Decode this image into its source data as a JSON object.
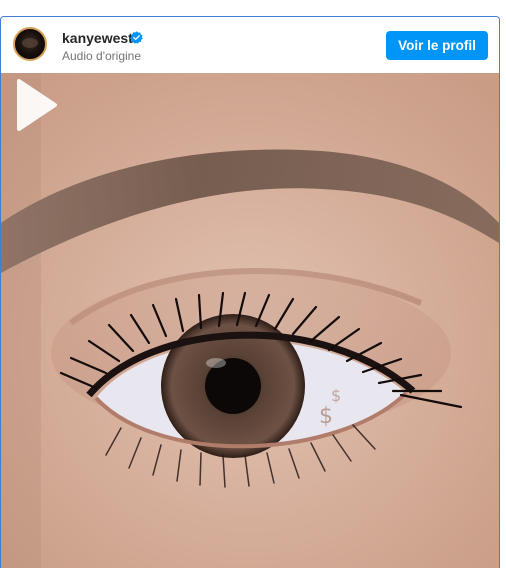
{
  "post": {
    "username": "kanyewest",
    "subtitle": "Audio d'origine",
    "profile_button_label": "Voir le profil"
  },
  "icons": {
    "verified": "verified-badge-icon",
    "play": "play-icon"
  },
  "colors": {
    "accent": "#0095f6",
    "border": "#3d7fd6"
  }
}
